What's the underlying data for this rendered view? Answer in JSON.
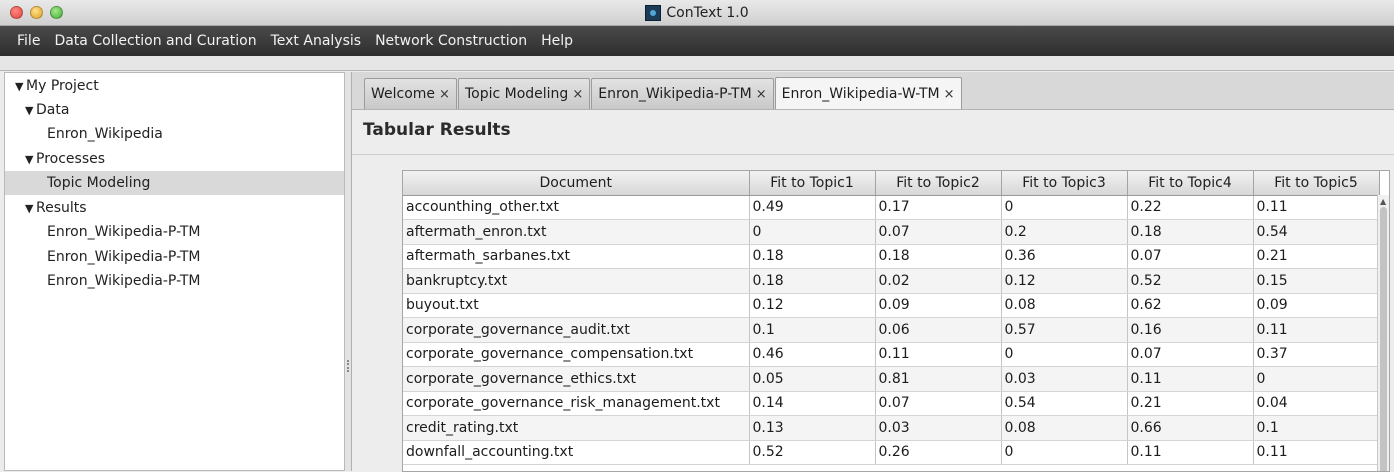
{
  "window": {
    "title": "ConText 1.0"
  },
  "menu": [
    "File",
    "Data Collection and Curation",
    "Text Analysis",
    "Network Construction",
    "Help"
  ],
  "tree": {
    "root": "My Project",
    "data_label": "Data",
    "data_items": [
      "Enron_Wikipedia"
    ],
    "processes_label": "Processes",
    "process_items": [
      "Topic Modeling"
    ],
    "results_label": "Results",
    "result_items": [
      "Enron_Wikipedia-P-TM",
      "Enron_Wikipedia-P-TM",
      "Enron_Wikipedia-P-TM"
    ]
  },
  "tabs": [
    "Welcome",
    "Topic Modeling",
    "Enron_Wikipedia-P-TM",
    "Enron_Wikipedia-W-TM"
  ],
  "active_tab_index": 3,
  "section_title": "Tabular Results",
  "table": {
    "headers": [
      "Document",
      "Fit to Topic1",
      "Fit to Topic2",
      "Fit to Topic3",
      "Fit to Topic4",
      "Fit to Topic5"
    ],
    "rows": [
      [
        "accounthing_other.txt",
        "0.49",
        "0.17",
        "0",
        "0.22",
        "0.11"
      ],
      [
        "aftermath_enron.txt",
        "0",
        "0.07",
        "0.2",
        "0.18",
        "0.54"
      ],
      [
        "aftermath_sarbanes.txt",
        "0.18",
        "0.18",
        "0.36",
        "0.07",
        "0.21"
      ],
      [
        "bankruptcy.txt",
        "0.18",
        "0.02",
        "0.12",
        "0.52",
        "0.15"
      ],
      [
        "buyout.txt",
        "0.12",
        "0.09",
        "0.08",
        "0.62",
        "0.09"
      ],
      [
        "corporate_governance_audit.txt",
        "0.1",
        "0.06",
        "0.57",
        "0.16",
        "0.11"
      ],
      [
        "corporate_governance_compensation.txt",
        "0.46",
        "0.11",
        "0",
        "0.07",
        "0.37"
      ],
      [
        "corporate_governance_ethics.txt",
        "0.05",
        "0.81",
        "0.03",
        "0.11",
        "0"
      ],
      [
        "corporate_governance_risk_management.txt",
        "0.14",
        "0.07",
        "0.54",
        "0.21",
        "0.04"
      ],
      [
        "credit_rating.txt",
        "0.13",
        "0.03",
        "0.08",
        "0.66",
        "0.1"
      ],
      [
        "downfall_accounting.txt",
        "0.52",
        "0.26",
        "0",
        "0.11",
        "0.11"
      ]
    ]
  },
  "tab_close_glyph": "×",
  "expand_glyph": "▼"
}
